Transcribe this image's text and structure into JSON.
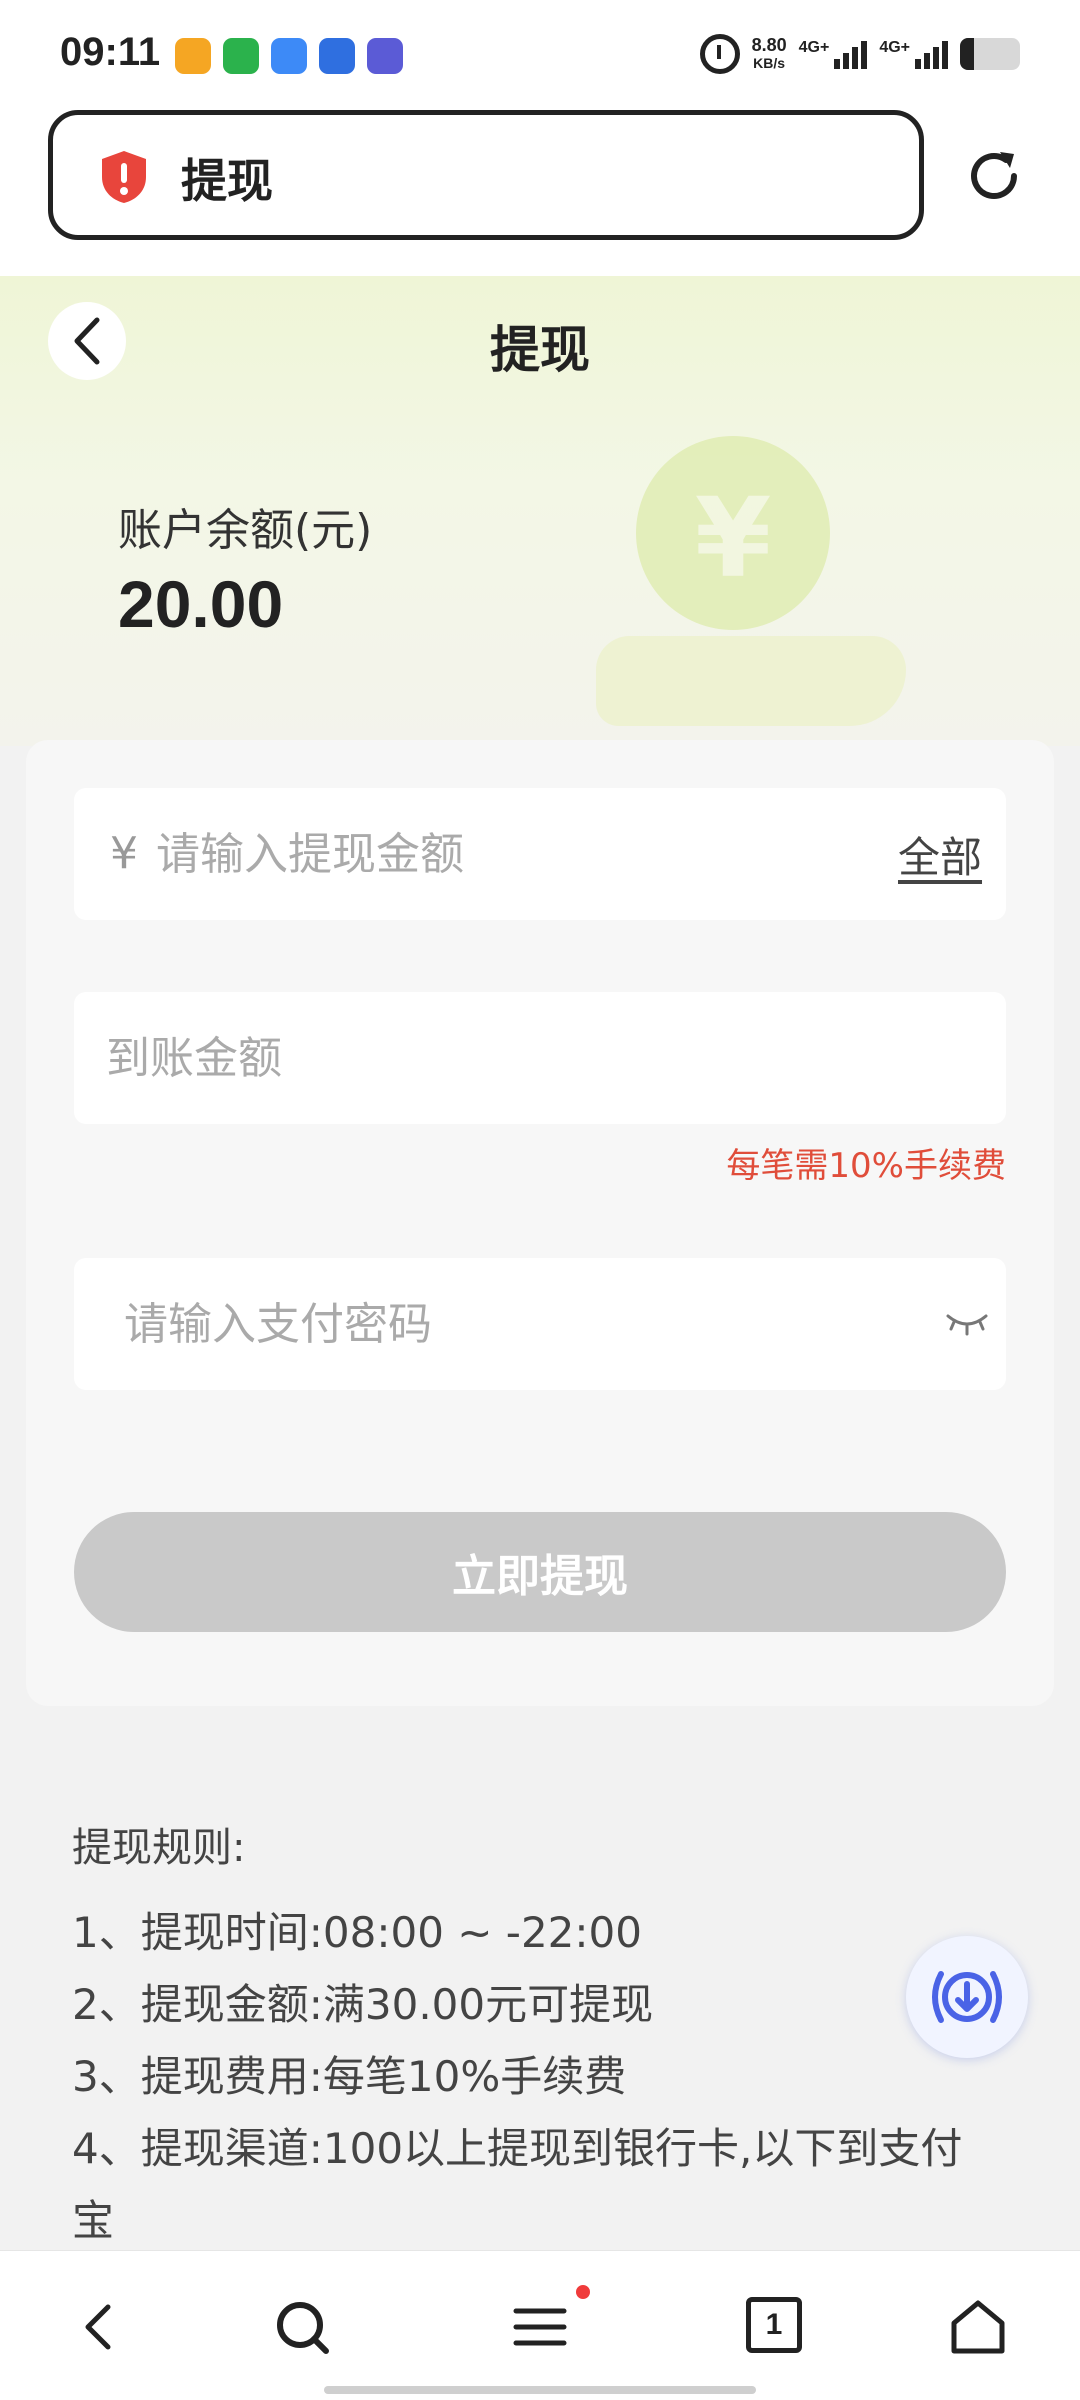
{
  "status": {
    "time": "09:11",
    "net_speed": "8.80",
    "net_unit": "KB/s",
    "sim1": "4G+",
    "sim2": "4G+"
  },
  "url_bar": {
    "title": "提现"
  },
  "header": {
    "title": "提现"
  },
  "balance": {
    "label": "账户余额(元)",
    "value": "20.00"
  },
  "form": {
    "amount_currency": "¥",
    "amount_placeholder": "请输入提现金额",
    "all_label": "全部",
    "received_placeholder": "到账金额",
    "fee_note": "每笔需10%手续费",
    "password_placeholder": "请输入支付密码",
    "submit_label": "立即提现"
  },
  "rules": {
    "title": "提现规则:",
    "items": [
      "1、提现时间:08:00 ~ -22:00",
      "2、提现金额:满30.00元可提现",
      "3、提现费用:每笔10%手续费",
      "4、提现渠道:100以上提现到银行卡,以下到支付宝"
    ]
  },
  "tabs": {
    "tab_count": "1"
  },
  "colors": {
    "accent_red": "#e04d3a",
    "button_disabled": "#c9c9c9",
    "hero_green": "#eff5d6",
    "float_blue": "#4a63e6"
  }
}
